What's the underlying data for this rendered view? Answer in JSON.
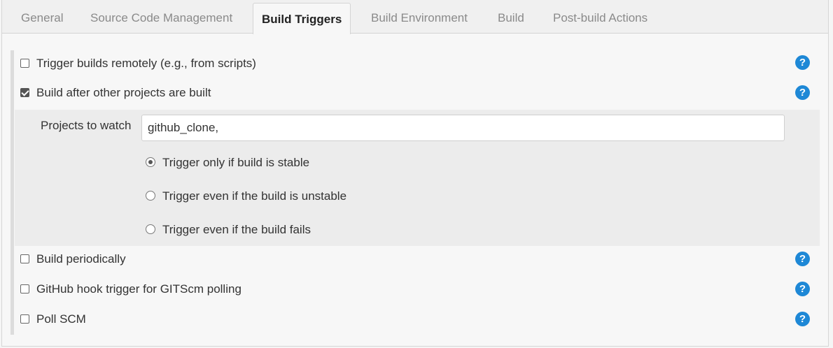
{
  "tabs": [
    {
      "label": "General"
    },
    {
      "label": "Source Code Management"
    },
    {
      "label": "Build Triggers"
    },
    {
      "label": "Build Environment"
    },
    {
      "label": "Build"
    },
    {
      "label": "Post-build Actions"
    }
  ],
  "active_tab": "Build Triggers",
  "triggers": {
    "remote": {
      "label": "Trigger builds remotely (e.g., from scripts)",
      "checked": false
    },
    "after_other": {
      "label": "Build after other projects are built",
      "checked": true
    },
    "periodic": {
      "label": "Build periodically",
      "checked": false
    },
    "github_hook": {
      "label": "GitHub hook trigger for GITScm polling",
      "checked": false
    },
    "poll_scm": {
      "label": "Poll SCM",
      "checked": false
    }
  },
  "watch": {
    "label": "Projects to watch",
    "value": "github_clone,"
  },
  "options": [
    {
      "label": "Trigger only if build is stable",
      "selected": true
    },
    {
      "label": "Trigger even if the build is unstable",
      "selected": false
    },
    {
      "label": "Trigger even if the build fails",
      "selected": false
    }
  ],
  "help_icon": "question-circle-icon",
  "help_glyph": "?",
  "colors": {
    "help": "#1e88d6",
    "accent": "#555555"
  }
}
